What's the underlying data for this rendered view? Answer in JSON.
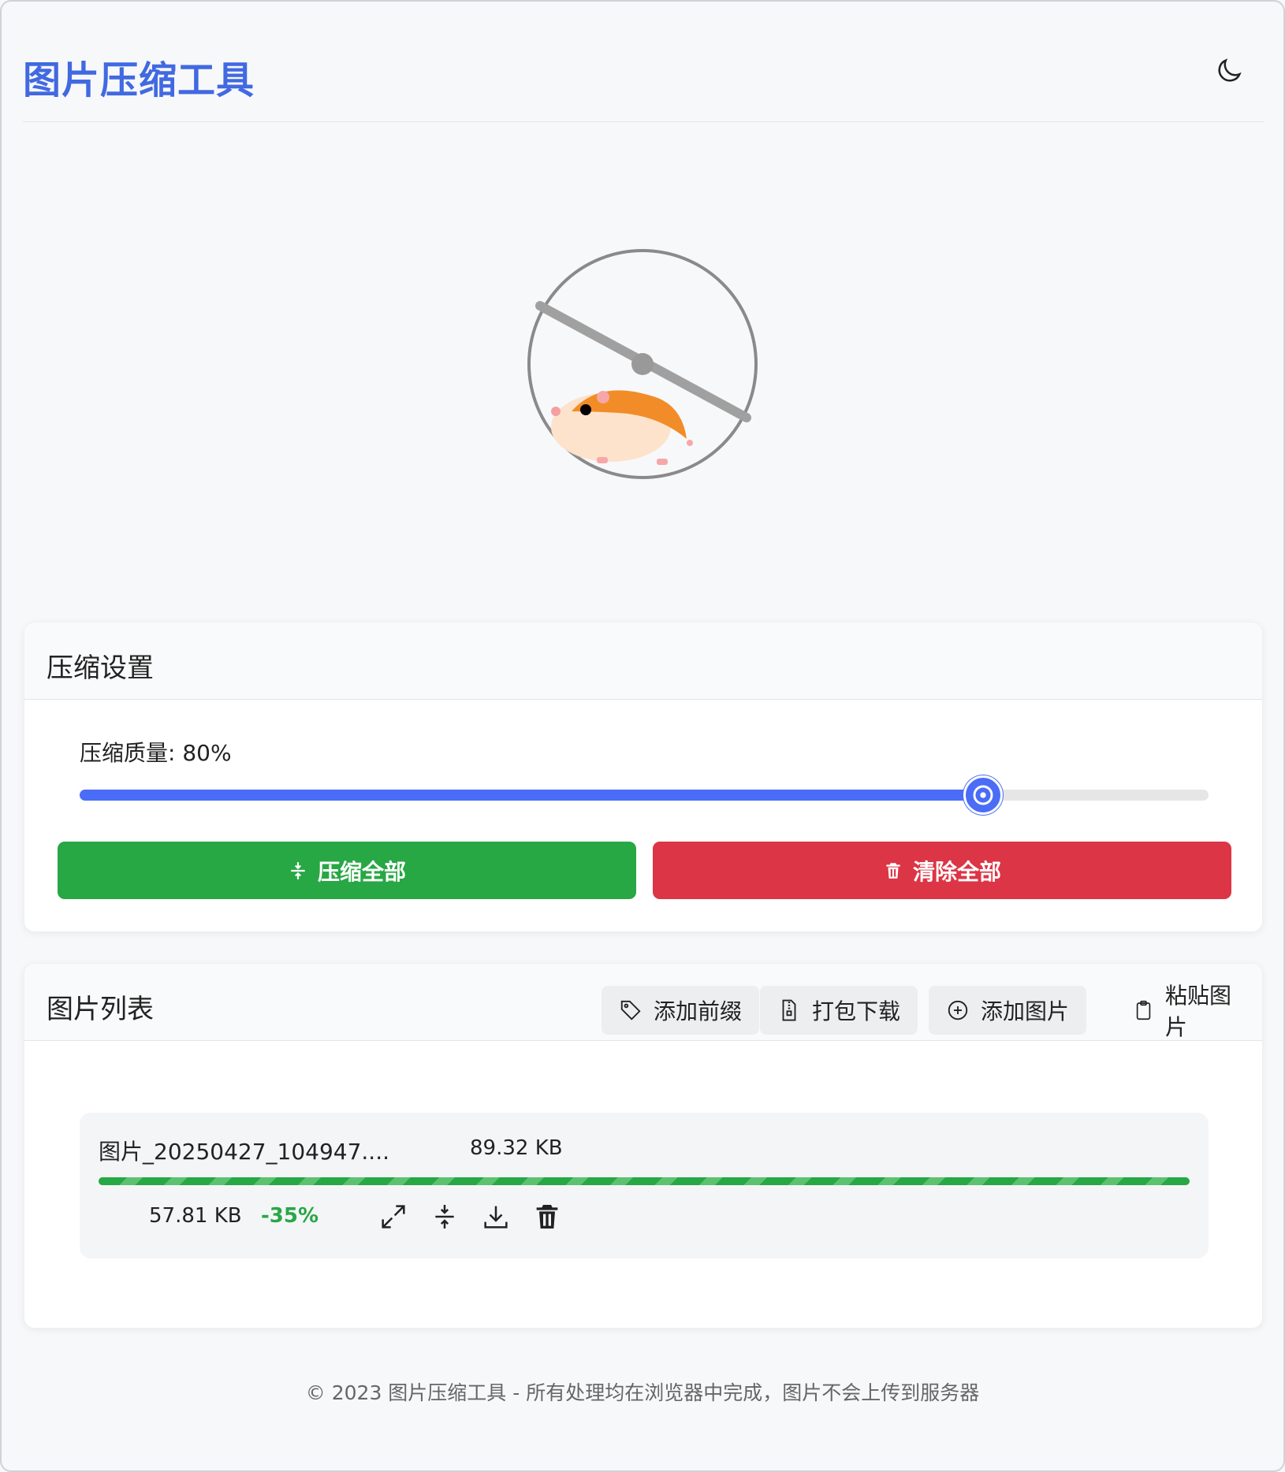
{
  "header": {
    "title": "图片压缩工具",
    "theme_icon": "moon-icon"
  },
  "hero": {
    "illustration": "hamster-wheel-icon"
  },
  "settings": {
    "title": "压缩设置",
    "quality_label": "压缩质量: 80%",
    "quality_value": 80,
    "compress_all_label": "压缩全部",
    "clear_all_label": "清除全部",
    "colors": {
      "accent": "#4a6cf7",
      "success": "#28a745",
      "danger": "#dc3545"
    }
  },
  "list": {
    "title": "图片列表",
    "toolbar": [
      {
        "label": "添加前缀",
        "icon": "tag-icon"
      },
      {
        "label": "打包下载",
        "icon": "zip-file-icon"
      },
      {
        "label": "添加图片",
        "icon": "plus-circle-icon"
      },
      {
        "label": "粘贴图片",
        "icon": "clipboard-icon"
      }
    ],
    "items": [
      {
        "name": "图片_20250427_104947....",
        "original_size": "89.32 KB",
        "compressed_size": "57.81 KB",
        "reduction": "-35%",
        "progress": 1.0
      }
    ]
  },
  "footer": {
    "text": "© 2023 图片压缩工具 - 所有处理均在浏览器中完成，图片不会上传到服务器"
  }
}
